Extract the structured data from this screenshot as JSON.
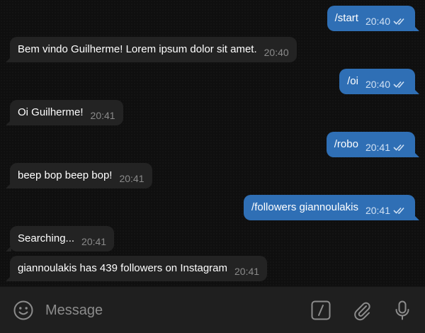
{
  "messages": [
    {
      "text": "/start",
      "time": "20:40",
      "direction": "out"
    },
    {
      "text": "Bem vindo Guilherme! Lorem ipsum dolor sit amet.",
      "time": "20:40",
      "direction": "in"
    },
    {
      "text": "/oi",
      "time": "20:40",
      "direction": "out"
    },
    {
      "text": "Oi Guilherme!",
      "time": "20:41",
      "direction": "in"
    },
    {
      "text": "/robo",
      "time": "20:41",
      "direction": "out"
    },
    {
      "text": "beep bop beep bop!",
      "time": "20:41",
      "direction": "in"
    },
    {
      "text": "/followers giannoulakis",
      "time": "20:41",
      "direction": "out"
    },
    {
      "text": "Searching...",
      "time": "20:41",
      "direction": "in"
    },
    {
      "text": "giannoulakis has 439 followers on Instagram",
      "time": "20:41",
      "direction": "in"
    }
  ],
  "input": {
    "placeholder": "Message",
    "value": ""
  },
  "icons": {
    "emoji": "emoji-icon",
    "commands": "slash-command-icon",
    "attach": "paperclip-icon",
    "mic": "microphone-icon",
    "read_receipt": "double-check-icon"
  },
  "colors": {
    "background": "#0f0f0f",
    "incoming_bubble": "#232323",
    "outgoing_bubble": "#2f6fb5",
    "input_bar": "#1f1f1f"
  }
}
